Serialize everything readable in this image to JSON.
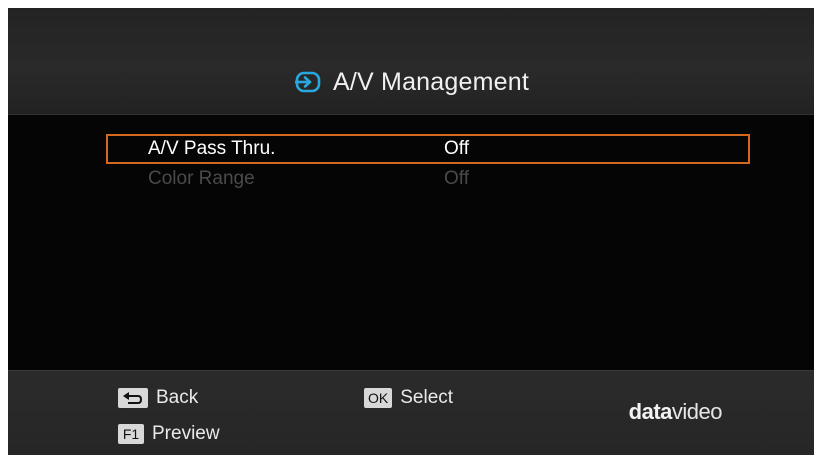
{
  "header": {
    "title": "A/V Management",
    "icon": "input-icon"
  },
  "menu": {
    "items": [
      {
        "label": "A/V Pass Thru.",
        "value": "Off",
        "state": "selected"
      },
      {
        "label": "Color Range",
        "value": "Off",
        "state": "disabled"
      }
    ]
  },
  "footer": {
    "back": {
      "key": "⮌",
      "label": "Back"
    },
    "preview": {
      "key": "F1",
      "label": "Preview"
    },
    "select": {
      "key": "OK",
      "label": "Select"
    },
    "brand": {
      "bold": "data",
      "light": "video"
    }
  },
  "colors": {
    "accent": "#d2691e",
    "icon": "#29a8e0"
  }
}
